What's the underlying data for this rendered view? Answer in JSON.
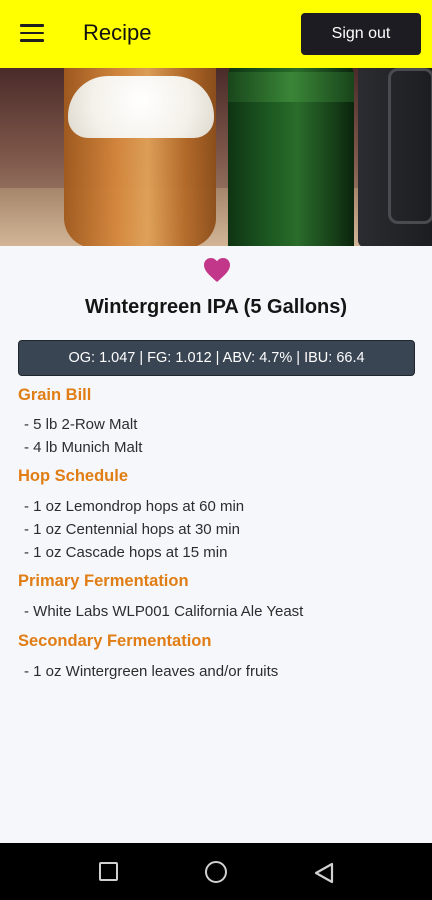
{
  "header": {
    "title": "Recipe",
    "signout_label": "Sign out",
    "bg_color": "#ffff00"
  },
  "hero": {
    "image": "beer-glass-and-bottle-photo"
  },
  "favorite": {
    "icon": "heart-icon",
    "color": "#c2378a"
  },
  "recipe": {
    "name": "Wintergreen IPA (5 Gallons)",
    "stats": "OG: 1.047 | FG: 1.012 | ABV: 4.7% | IBU: 66.4",
    "sections": [
      {
        "title": "Grain Bill",
        "items": [
          "- 5 lb 2-Row Malt",
          "- 4 lb Munich Malt"
        ]
      },
      {
        "title": "Hop Schedule",
        "items": [
          "- 1 oz Lemondrop hops at 60 min",
          "- 1 oz Centennial hops at 30 min",
          "- 1 oz Cascade hops at 15 min"
        ]
      },
      {
        "title": "Primary Fermentation",
        "items": [
          "- White Labs WLP001 California Ale Yeast"
        ]
      },
      {
        "title": "Secondary Fermentation",
        "items": [
          "- 1 oz Wintergreen leaves and/or fruits"
        ]
      }
    ],
    "accent_color": "#e07d14"
  },
  "navbar": {
    "icons": [
      "recent-apps-icon",
      "home-icon",
      "back-icon"
    ]
  }
}
